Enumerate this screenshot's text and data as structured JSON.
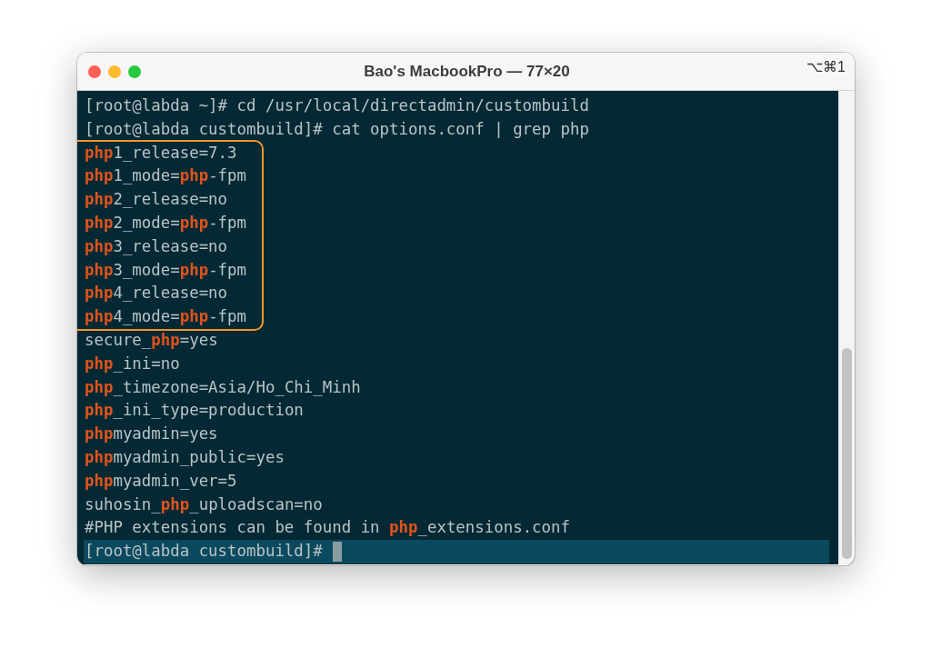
{
  "window": {
    "title": "Bao's MacbookPro — 77×20",
    "shortcut": "⌥⌘1"
  },
  "blocks": [
    {
      "highlighted": false,
      "lines": [
        "[root@labda ~]# cd /usr/local/directadmin/custombuild",
        "[root@labda custombuild]# cat options.conf | grep php"
      ]
    },
    {
      "highlighted": true,
      "lines": [
        "**php**1_release=7.3",
        "**php**1_mode=**php**-fpm",
        "**php**2_release=no",
        "**php**2_mode=**php**-fpm",
        "**php**3_release=no",
        "**php**3_mode=**php**-fpm",
        "**php**4_release=no",
        "**php**4_mode=**php**-fpm"
      ]
    },
    {
      "highlighted": false,
      "lines": [
        "secure_**php**=yes",
        "**php**_ini=no",
        "**php**_timezone=Asia/Ho_Chi_Minh",
        "**php**_ini_type=production",
        "**php**myadmin=yes",
        "**php**myadmin_public=yes",
        "**php**myadmin_ver=5",
        "suhosin_**php**_uploadscan=no",
        "#PHP extensions can be found in **php**_extensions.conf"
      ]
    }
  ],
  "prompt": {
    "text": "[root@labda custombuild]#",
    "selected": true
  }
}
